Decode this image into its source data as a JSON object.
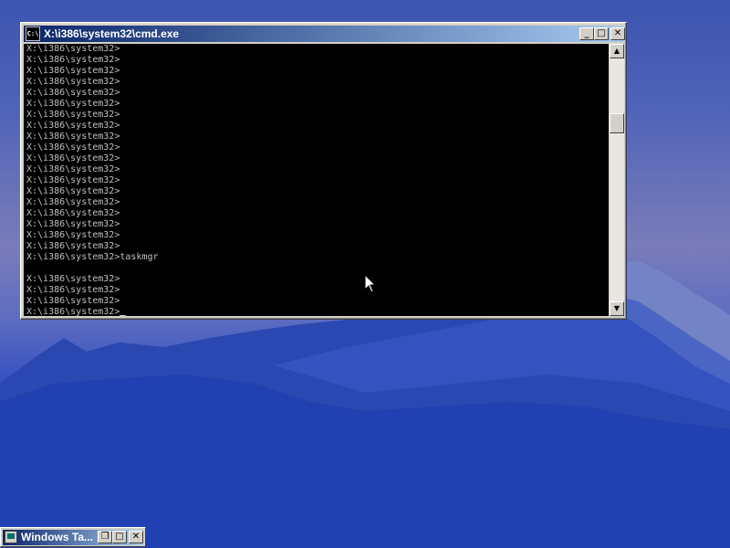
{
  "cmd_window": {
    "title": "X:\\i386\\system32\\cmd.exe",
    "icon_label": "C:\\",
    "minimize_glyph": "_",
    "maximize_glyph": "□",
    "close_glyph": "✕",
    "console_lines": [
      "X:\\i386\\system32>",
      "X:\\i386\\system32>",
      "X:\\i386\\system32>",
      "X:\\i386\\system32>",
      "X:\\i386\\system32>",
      "X:\\i386\\system32>",
      "X:\\i386\\system32>",
      "X:\\i386\\system32>",
      "X:\\i386\\system32>",
      "X:\\i386\\system32>",
      "X:\\i386\\system32>",
      "X:\\i386\\system32>",
      "X:\\i386\\system32>",
      "X:\\i386\\system32>",
      "X:\\i386\\system32>",
      "X:\\i386\\system32>",
      "X:\\i386\\system32>",
      "X:\\i386\\system32>",
      "X:\\i386\\system32>",
      "X:\\i386\\system32>taskmgr",
      "",
      "X:\\i386\\system32>",
      "X:\\i386\\system32>",
      "X:\\i386\\system32>",
      "X:\\i386\\system32>"
    ],
    "scroll_up_glyph": "▲",
    "scroll_down_glyph": "▼"
  },
  "minimized_window": {
    "title": "Windows Ta...",
    "restore_glyph": "❐",
    "maximize_glyph": "□",
    "close_glyph": "✕"
  },
  "colors": {
    "titlebar_active": "#0a246a",
    "console_bg": "#000000",
    "console_fg": "#c0c0c0",
    "window_face": "#d4d0c8"
  }
}
